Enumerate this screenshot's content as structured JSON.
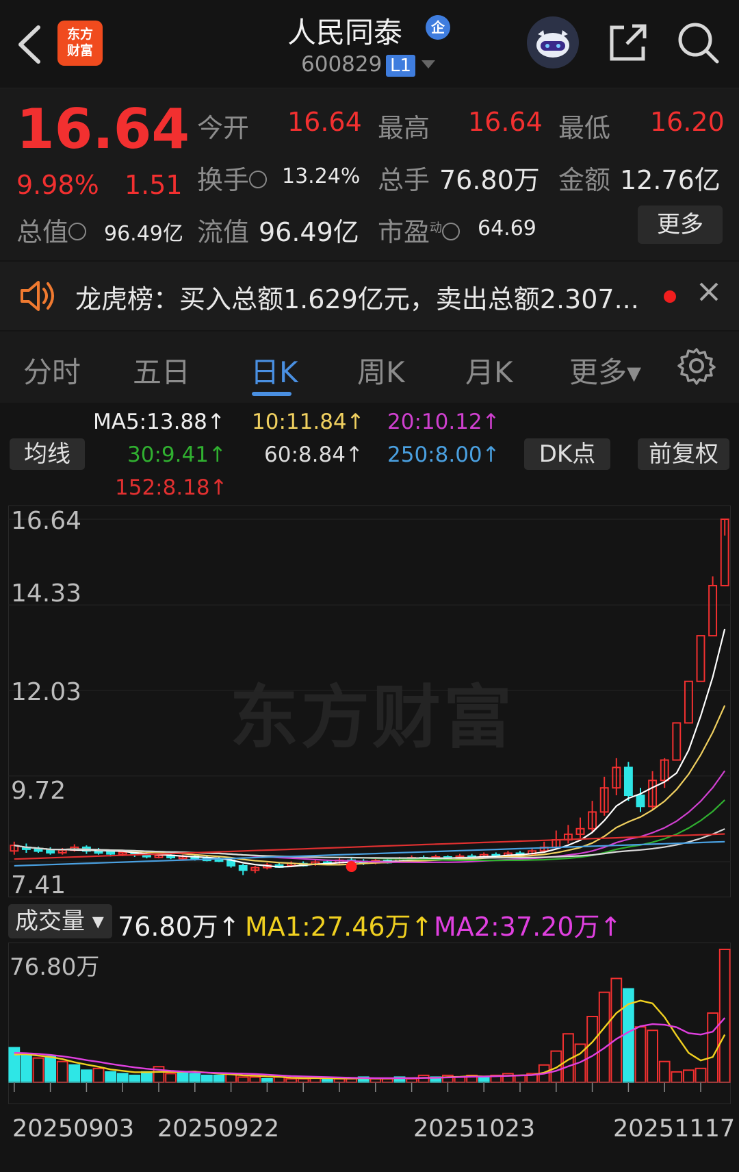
{
  "header": {
    "logo_line1": "东方",
    "logo_line2": "财富",
    "title": "人民同泰",
    "title_badge": "企",
    "code": "600829",
    "level": "L1"
  },
  "quote": {
    "price": "16.64",
    "pct": "9.98%",
    "change": "1.51",
    "open_label": "今开",
    "open": "16.64",
    "high_label": "最高",
    "high": "16.64",
    "low_label": "最低",
    "low": "16.20",
    "turnover_label": "换手",
    "turnover": "13.24%",
    "volume_label": "总手",
    "volume": "76.80万",
    "amount_label": "金额",
    "amount": "12.76亿",
    "mktcap_label": "总值",
    "mktcap": "96.49亿",
    "float_label": "流值",
    "float": "96.49亿",
    "pe_label": "市盈",
    "pe_sup": "动",
    "pe": "64.69",
    "more_label": "更多"
  },
  "notice": {
    "text": "龙虎榜：买入总额1.629亿元，卖出总额2.307..."
  },
  "tabs": [
    "分时",
    "五日",
    "日K",
    "周K",
    "月K",
    "更多▾"
  ],
  "ma": {
    "ma_btn": "均线",
    "ma5": "MA5:13.88↑",
    "ma10": "10:11.84↑",
    "ma20": "20:10.12↑",
    "ma30": "30:9.41↑",
    "ma60": "60:8.84↑",
    "ma250": "250:8.00↑",
    "ma152": "152:8.18↑",
    "dk_btn": "DK点",
    "adjust_btn": "前复权"
  },
  "volume_row": {
    "label": "成交量",
    "value": "76.80万↑",
    "ma1": "MA1:27.46万↑",
    "ma2": "MA2:37.20万↑"
  },
  "watermark": "东方财富",
  "colors": {
    "up": "#f23030",
    "down": "#2ee6e6",
    "ma5": "#ffffff",
    "ma10": "#f0d060",
    "ma20": "#d040d0",
    "ma30": "#30b030",
    "ma60": "#d8d8d8",
    "ma250": "#4aa0e0",
    "ma152": "#e03030"
  },
  "chart_data": {
    "type": "candlestick",
    "y_ticks": [
      "16.64",
      "14.33",
      "12.03",
      "9.72",
      "7.41"
    ],
    "ylim": [
      7.41,
      16.64
    ],
    "vol_label": "76.80万",
    "vol_max": 76.8,
    "x_labels": [
      "20250903",
      "20250922",
      "20251023",
      "20251117"
    ],
    "candles": [
      {
        "o": 7.7,
        "c": 7.85,
        "h": 7.95,
        "l": 7.6
      },
      {
        "o": 7.8,
        "c": 7.75,
        "h": 7.9,
        "l": 7.65
      },
      {
        "o": 7.75,
        "c": 7.72,
        "h": 7.82,
        "l": 7.65
      },
      {
        "o": 7.72,
        "c": 7.65,
        "h": 7.8,
        "l": 7.6
      },
      {
        "o": 7.65,
        "c": 7.72,
        "h": 7.78,
        "l": 7.6
      },
      {
        "o": 7.72,
        "c": 7.8,
        "h": 7.88,
        "l": 7.68
      },
      {
        "o": 7.8,
        "c": 7.7,
        "h": 7.85,
        "l": 7.62
      },
      {
        "o": 7.7,
        "c": 7.68,
        "h": 7.78,
        "l": 7.6
      },
      {
        "o": 7.68,
        "c": 7.62,
        "h": 7.72,
        "l": 7.55
      },
      {
        "o": 7.62,
        "c": 7.66,
        "h": 7.7,
        "l": 7.56
      },
      {
        "o": 7.66,
        "c": 7.6,
        "h": 7.72,
        "l": 7.54
      },
      {
        "o": 7.6,
        "c": 7.56,
        "h": 7.66,
        "l": 7.5
      },
      {
        "o": 7.56,
        "c": 7.58,
        "h": 7.64,
        "l": 7.5
      },
      {
        "o": 7.58,
        "c": 7.52,
        "h": 7.62,
        "l": 7.48
      },
      {
        "o": 7.52,
        "c": 7.55,
        "h": 7.6,
        "l": 7.46
      },
      {
        "o": 7.55,
        "c": 7.5,
        "h": 7.6,
        "l": 7.44
      },
      {
        "o": 7.5,
        "c": 7.48,
        "h": 7.56,
        "l": 7.42
      },
      {
        "o": 7.48,
        "c": 7.45,
        "h": 7.54,
        "l": 7.4
      },
      {
        "o": 7.45,
        "c": 7.3,
        "h": 7.5,
        "l": 7.25
      },
      {
        "o": 7.3,
        "c": 7.18,
        "h": 7.35,
        "l": 7.05
      },
      {
        "o": 7.18,
        "c": 7.25,
        "h": 7.3,
        "l": 7.1
      },
      {
        "o": 7.25,
        "c": 7.32,
        "h": 7.38,
        "l": 7.2
      },
      {
        "o": 7.32,
        "c": 7.3,
        "h": 7.4,
        "l": 7.25
      },
      {
        "o": 7.3,
        "c": 7.36,
        "h": 7.42,
        "l": 7.26
      },
      {
        "o": 7.36,
        "c": 7.34,
        "h": 7.42,
        "l": 7.28
      },
      {
        "o": 7.34,
        "c": 7.4,
        "h": 7.46,
        "l": 7.3
      },
      {
        "o": 7.4,
        "c": 7.38,
        "h": 7.46,
        "l": 7.32
      },
      {
        "o": 7.38,
        "c": 7.45,
        "h": 7.5,
        "l": 7.34
      },
      {
        "o": 7.45,
        "c": 7.42,
        "h": 7.52,
        "l": 7.38
      },
      {
        "o": 7.42,
        "c": 7.38,
        "h": 7.48,
        "l": 7.32
      },
      {
        "o": 7.38,
        "c": 7.44,
        "h": 7.5,
        "l": 7.34
      },
      {
        "o": 7.44,
        "c": 7.4,
        "h": 7.48,
        "l": 7.36
      },
      {
        "o": 7.4,
        "c": 7.48,
        "h": 7.54,
        "l": 7.38
      },
      {
        "o": 7.48,
        "c": 7.52,
        "h": 7.58,
        "l": 7.44
      },
      {
        "o": 7.52,
        "c": 7.5,
        "h": 7.58,
        "l": 7.46
      },
      {
        "o": 7.5,
        "c": 7.54,
        "h": 7.6,
        "l": 7.46
      },
      {
        "o": 7.54,
        "c": 7.48,
        "h": 7.58,
        "l": 7.44
      },
      {
        "o": 7.48,
        "c": 7.56,
        "h": 7.62,
        "l": 7.45
      },
      {
        "o": 7.56,
        "c": 7.54,
        "h": 7.62,
        "l": 7.5
      },
      {
        "o": 7.54,
        "c": 7.6,
        "h": 7.66,
        "l": 7.5
      },
      {
        "o": 7.6,
        "c": 7.58,
        "h": 7.66,
        "l": 7.54
      },
      {
        "o": 7.58,
        "c": 7.64,
        "h": 7.7,
        "l": 7.54
      },
      {
        "o": 7.64,
        "c": 7.62,
        "h": 7.7,
        "l": 7.58
      },
      {
        "o": 7.62,
        "c": 7.7,
        "h": 7.76,
        "l": 7.58
      },
      {
        "o": 7.7,
        "c": 7.8,
        "h": 7.95,
        "l": 7.66
      },
      {
        "o": 7.8,
        "c": 8.0,
        "h": 8.25,
        "l": 7.75
      },
      {
        "o": 8.0,
        "c": 8.15,
        "h": 8.4,
        "l": 7.9
      },
      {
        "o": 8.15,
        "c": 8.3,
        "h": 8.6,
        "l": 8.05
      },
      {
        "o": 8.3,
        "c": 8.75,
        "h": 9.05,
        "l": 8.2
      },
      {
        "o": 8.75,
        "c": 9.4,
        "h": 9.7,
        "l": 8.65
      },
      {
        "o": 9.4,
        "c": 9.95,
        "h": 10.2,
        "l": 9.2
      },
      {
        "o": 9.95,
        "c": 9.2,
        "h": 10.1,
        "l": 9.05
      },
      {
        "o": 9.2,
        "c": 8.9,
        "h": 9.4,
        "l": 8.75
      },
      {
        "o": 8.9,
        "c": 9.6,
        "h": 9.85,
        "l": 8.8
      },
      {
        "o": 9.6,
        "c": 10.15,
        "h": 10.2,
        "l": 9.4
      },
      {
        "o": 10.15,
        "c": 11.15,
        "h": 11.15,
        "l": 11.15
      },
      {
        "o": 11.15,
        "c": 12.27,
        "h": 12.27,
        "l": 12.27
      },
      {
        "o": 12.27,
        "c": 13.5,
        "h": 13.5,
        "l": 13.5
      },
      {
        "o": 13.5,
        "c": 14.85,
        "h": 15.1,
        "l": 14.85
      },
      {
        "o": 14.85,
        "c": 16.64,
        "h": 16.64,
        "l": 16.2
      }
    ],
    "volumes": [
      {
        "v": 20,
        "up": false
      },
      {
        "v": 16,
        "up": false
      },
      {
        "v": 14,
        "up": true
      },
      {
        "v": 15,
        "up": false
      },
      {
        "v": 12,
        "up": true
      },
      {
        "v": 10,
        "up": false
      },
      {
        "v": 7,
        "up": false
      },
      {
        "v": 8,
        "up": true
      },
      {
        "v": 6,
        "up": false
      },
      {
        "v": 5,
        "up": false
      },
      {
        "v": 4,
        "up": false
      },
      {
        "v": 6,
        "up": false
      },
      {
        "v": 9,
        "up": true
      },
      {
        "v": 5,
        "up": true
      },
      {
        "v": 6,
        "up": false
      },
      {
        "v": 5,
        "up": false
      },
      {
        "v": 4,
        "up": false
      },
      {
        "v": 4,
        "up": false
      },
      {
        "v": 5,
        "up": true
      },
      {
        "v": 3,
        "up": true
      },
      {
        "v": 3,
        "up": true
      },
      {
        "v": 2,
        "up": false
      },
      {
        "v": 3,
        "up": true
      },
      {
        "v": 2,
        "up": true
      },
      {
        "v": 2,
        "up": true
      },
      {
        "v": 3,
        "up": true
      },
      {
        "v": 2,
        "up": false
      },
      {
        "v": 2,
        "up": true
      },
      {
        "v": 2,
        "up": true
      },
      {
        "v": 3,
        "up": false
      },
      {
        "v": 2,
        "up": true
      },
      {
        "v": 2,
        "up": true
      },
      {
        "v": 3,
        "up": false
      },
      {
        "v": 2,
        "up": true
      },
      {
        "v": 4,
        "up": true
      },
      {
        "v": 3,
        "up": false
      },
      {
        "v": 4,
        "up": true
      },
      {
        "v": 3,
        "up": true
      },
      {
        "v": 4,
        "up": true
      },
      {
        "v": 3,
        "up": false
      },
      {
        "v": 4,
        "up": true
      },
      {
        "v": 5,
        "up": true
      },
      {
        "v": 4,
        "up": true
      },
      {
        "v": 5,
        "up": true
      },
      {
        "v": 10,
        "up": true
      },
      {
        "v": 18,
        "up": true
      },
      {
        "v": 28,
        "up": true
      },
      {
        "v": 22,
        "up": true
      },
      {
        "v": 38,
        "up": true
      },
      {
        "v": 52,
        "up": true
      },
      {
        "v": 60,
        "up": true
      },
      {
        "v": 54,
        "up": false
      },
      {
        "v": 32,
        "up": true
      },
      {
        "v": 30,
        "up": true
      },
      {
        "v": 12,
        "up": true
      },
      {
        "v": 6,
        "up": true
      },
      {
        "v": 7,
        "up": true
      },
      {
        "v": 8,
        "up": true
      },
      {
        "v": 40,
        "up": true
      },
      {
        "v": 76.8,
        "up": true
      }
    ],
    "vol_ma1": [
      16,
      16.2,
      15.4,
      14.6,
      13.4,
      11.6,
      10.2,
      9.0,
      7.4,
      6.6,
      5.8,
      5.8,
      6.0,
      6.0,
      6.0,
      6.2,
      5.6,
      5.0,
      4.6,
      4.0,
      3.8,
      3.4,
      3.2,
      2.6,
      2.4,
      2.4,
      2.4,
      2.2,
      2.2,
      2.4,
      2.2,
      2.2,
      2.4,
      2.4,
      2.6,
      2.6,
      3.0,
      3.2,
      3.6,
      3.4,
      3.6,
      3.8,
      4.0,
      4.2,
      5.6,
      8.4,
      13.0,
      16.6,
      23.2,
      31.6,
      40.0,
      45.2,
      47.2,
      45.6,
      37.6,
      27.0,
      17.0,
      12.6,
      14.6,
      27.5
    ],
    "vol_ma2": [
      17,
      16.8,
      16.4,
      15.8,
      15.0,
      14.0,
      12.8,
      11.8,
      10.6,
      9.6,
      8.6,
      7.8,
      7.2,
      6.6,
      6.2,
      5.8,
      5.6,
      5.4,
      5.2,
      5.0,
      4.8,
      4.4,
      4.0,
      3.6,
      3.4,
      3.2,
      3.0,
      2.8,
      2.6,
      2.5,
      2.4,
      2.4,
      2.4,
      2.4,
      2.5,
      2.6,
      2.8,
      3.0,
      3.2,
      3.3,
      3.5,
      3.7,
      3.9,
      4.2,
      5.0,
      6.6,
      9.2,
      11.6,
      15.2,
      19.8,
      25.0,
      29.0,
      32.4,
      33.6,
      33.2,
      31.8,
      28.4,
      27.6,
      29.2,
      37.2
    ]
  }
}
